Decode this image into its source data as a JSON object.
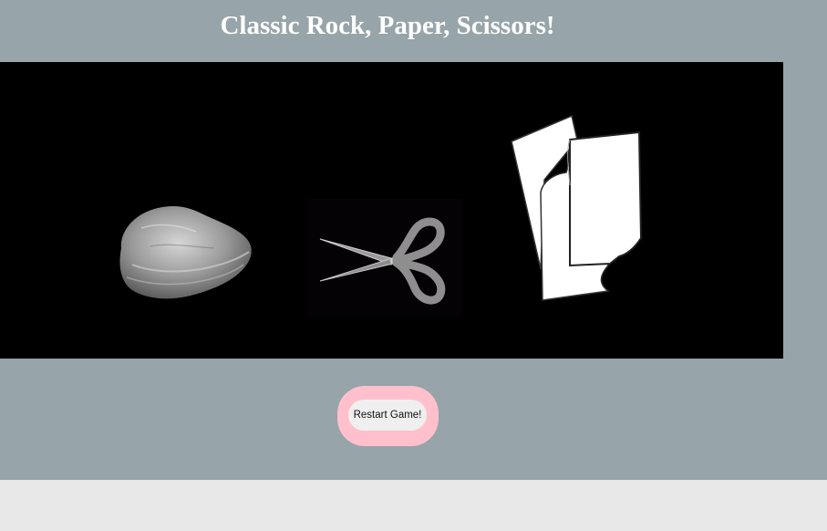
{
  "page": {
    "title": "Classic Rock, Paper, Scissors!"
  },
  "choices": [
    {
      "id": "rock",
      "icon": "rock-icon"
    },
    {
      "id": "scissors",
      "icon": "scissors-icon"
    },
    {
      "id": "paper",
      "icon": "paper-icon"
    }
  ],
  "controls": {
    "restart_label": "Restart Game!"
  },
  "colors": {
    "background": "#97a4a9",
    "board": "#000000",
    "restart_frame": "#ffc0cb",
    "restart_button": "#efefef",
    "page_below": "#e8e8e8"
  }
}
